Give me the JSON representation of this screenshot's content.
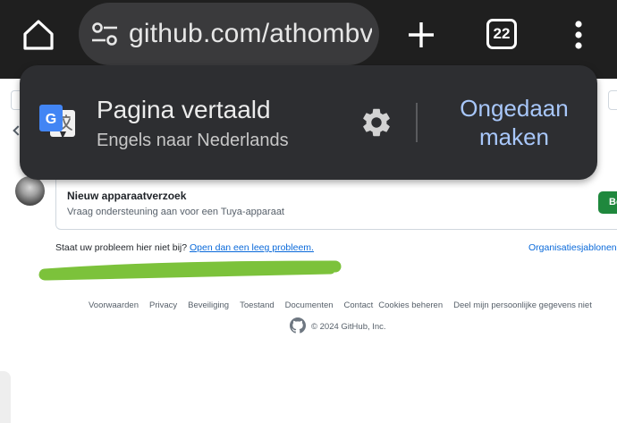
{
  "browser": {
    "url": "github.com/athombv",
    "tab_count": "22",
    "icons": [
      "home-icon",
      "tune-icon",
      "plus-icon",
      "tab-switcher-icon",
      "more-vert-icon"
    ]
  },
  "translate_popup": {
    "title": "Pagina vertaald",
    "subtitle": "Engels naar Nederlands",
    "undo_label_line1": "Ongedaan",
    "undo_label_line2": "maken",
    "icons": [
      "google-translate-icon",
      "gear-icon"
    ]
  },
  "template_card": {
    "title": "Nieuw apparaatverzoek",
    "description": "Vraag ondersteuning aan voor een Tuya-apparaat",
    "button_label": "Beginnen"
  },
  "blank_issue": {
    "prompt": "Staat uw probleem hier niet bij?",
    "link": "Open dan een leeg probleem.",
    "org_link": "Organisatiesjablonen"
  },
  "footer": {
    "links": [
      "Voorwaarden",
      "Privacy",
      "Beveiliging",
      "Toestand",
      "Documenten",
      "Contact",
      "Cookies beheren",
      "Deel mijn persoonlijke gegevens niet"
    ],
    "copyright": "© 2024 GitHub, Inc."
  },
  "colors": {
    "toolbar_bg": "#1f1f1f",
    "popup_bg": "#2d2e31",
    "popup_action": "#a8c7fa",
    "primary_button": "#1f883d",
    "link": "#0969da",
    "scribble": "#7cc23b"
  }
}
